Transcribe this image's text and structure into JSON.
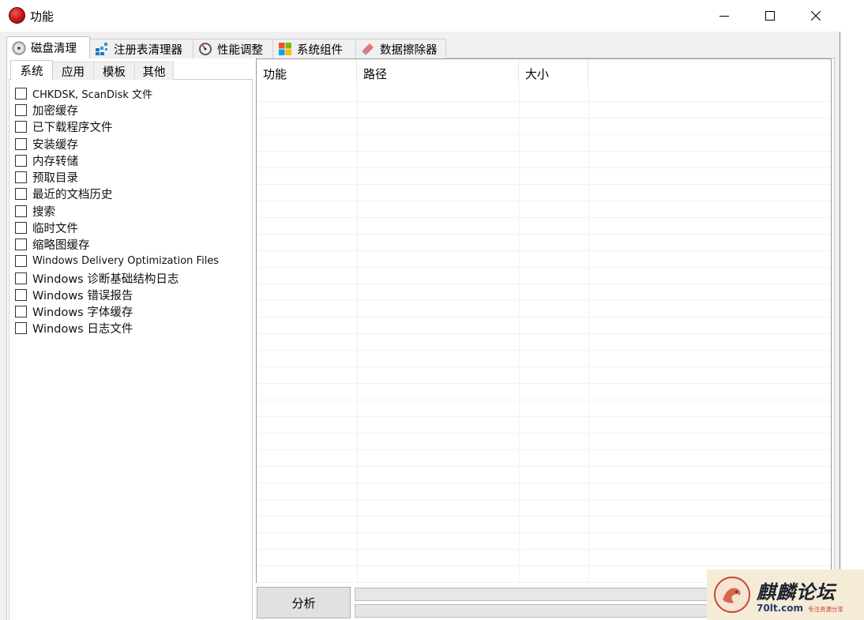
{
  "window": {
    "title": "功能",
    "controls": {
      "minimize": "minimize-icon",
      "maximize": "maximize-icon",
      "close": "close-icon"
    }
  },
  "main_tabs": [
    {
      "label": "磁盘清理",
      "icon": "disk-icon",
      "active": true
    },
    {
      "label": "注册表清理器",
      "icon": "registry-icon",
      "active": false
    },
    {
      "label": "性能调整",
      "icon": "gauge-icon",
      "active": false
    },
    {
      "label": "系统组件",
      "icon": "windows-logo-icon",
      "active": false
    },
    {
      "label": "数据擦除器",
      "icon": "eraser-icon",
      "active": false
    }
  ],
  "sub_tabs": [
    {
      "label": "系统",
      "active": true
    },
    {
      "label": "应用",
      "active": false
    },
    {
      "label": "模板",
      "active": false
    },
    {
      "label": "其他",
      "active": false
    }
  ],
  "items": [
    {
      "label": "CHKDSK, ScanDisk 文件",
      "checked": false
    },
    {
      "label": "加密缓存",
      "checked": false
    },
    {
      "label": "已下载程序文件",
      "checked": false
    },
    {
      "label": "安装缓存",
      "checked": false
    },
    {
      "label": "内存转储",
      "checked": false
    },
    {
      "label": "预取目录",
      "checked": false
    },
    {
      "label": "最近的文档历史",
      "checked": false
    },
    {
      "label": "搜索",
      "checked": false
    },
    {
      "label": "临时文件",
      "checked": false
    },
    {
      "label": "缩略图缓存",
      "checked": false
    },
    {
      "label": "Windows Delivery Optimization Files",
      "checked": false
    },
    {
      "label": "Windows 诊断基础结构日志",
      "checked": false
    },
    {
      "label": "Windows 错误报告",
      "checked": false
    },
    {
      "label": "Windows 字体缓存",
      "checked": false
    },
    {
      "label": "Windows 日志文件",
      "checked": false
    }
  ],
  "results_table": {
    "columns": [
      "功能",
      "路径",
      "大小"
    ],
    "rows": []
  },
  "analyze_button": "分析",
  "progress": [
    0,
    0
  ],
  "watermark": {
    "brand": "麒麟论坛",
    "site": "70lt.com",
    "slogan": "专注资源分享"
  },
  "colors": {
    "progress_fill": "#06b025",
    "close_accent": "#c41414"
  }
}
